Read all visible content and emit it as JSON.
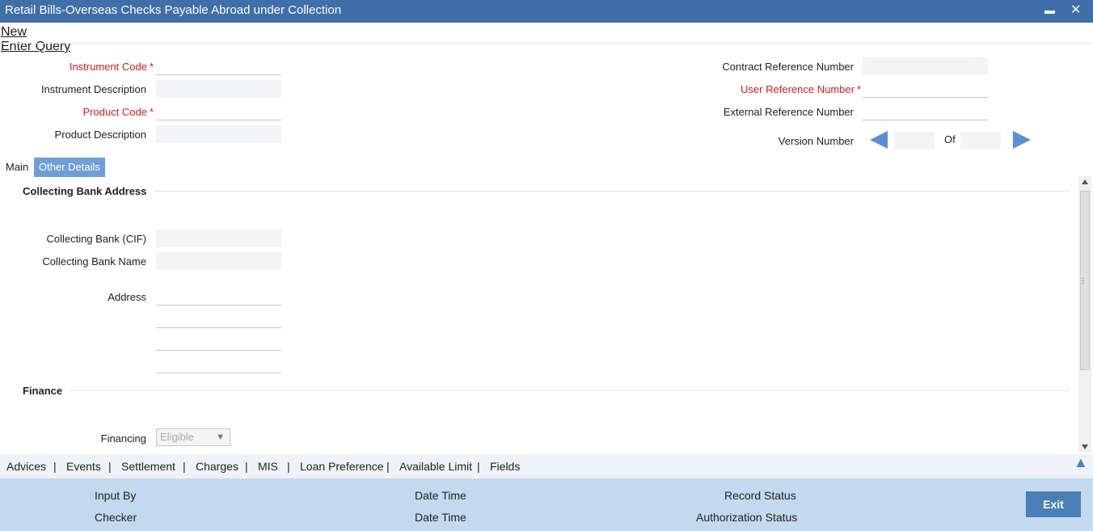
{
  "window": {
    "title": "Retail Bills-Overseas Checks Payable Abroad under Collection",
    "minimize": "▬",
    "close": "✕"
  },
  "toolbar": {
    "new_label": "New",
    "enter_query_label": "Enter Query"
  },
  "header": {
    "instrument_code_label": "Instrument Code",
    "instrument_description_label": "Instrument Description",
    "product_code_label": "Product Code",
    "product_description_label": "Product Description",
    "contract_ref_label": "Contract Reference Number",
    "user_ref_label": "User Reference Number",
    "external_ref_label": "External Reference Number",
    "version_number_label": "Version Number",
    "of_label": "Of",
    "required_mark": "*"
  },
  "tabs": {
    "main": "Main",
    "other_details": "Other Details"
  },
  "collecting_bank": {
    "section_title": "Collecting Bank Address",
    "cif_label": "Collecting Bank (CIF)",
    "name_label": "Collecting Bank Name",
    "address_label": "Address"
  },
  "finance": {
    "section_title": "Finance",
    "financing_label": "Financing",
    "financing_value": "Eligible"
  },
  "links": [
    "Advices",
    "Events",
    "Settlement",
    "Charges",
    "MIS",
    "Loan Preference",
    "Available Limit",
    "Fields"
  ],
  "link_separator": "|",
  "footer": {
    "input_by": "Input By",
    "date_time_1": "Date Time",
    "record_status": "Record Status",
    "checker": "Checker",
    "date_time_2": "Date Time",
    "authorization_status": "Authorization Status",
    "exit_label": "Exit"
  },
  "colors": {
    "titlebar": "#3f6ea8",
    "accent_tab": "#6e9fd6",
    "required": "#cc1f1f",
    "footer": "#c3d9ee",
    "exit_button": "#4a7fb5"
  }
}
